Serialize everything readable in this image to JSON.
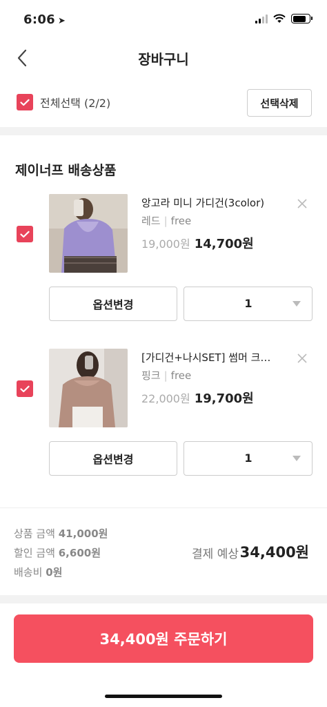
{
  "status": {
    "time": "6:06"
  },
  "header": {
    "title": "장바구니"
  },
  "select_all": {
    "label": "전체선택 (2/2)",
    "delete_label": "선택삭제"
  },
  "section": {
    "title": "제이너프 배송상품"
  },
  "items": [
    {
      "name": "앙고라 미니 가디건(3color)",
      "color": "레드",
      "size": "free",
      "price_original": "19,000원",
      "price_sale": "14,700원",
      "option_button": "옵션변경",
      "quantity": "1"
    },
    {
      "name": "[가디건+나시SET] 썸머 크…",
      "color": "핑크",
      "size": "free",
      "price_original": "22,000원",
      "price_sale": "19,700원",
      "option_button": "옵션변경",
      "quantity": "1"
    }
  ],
  "summary": {
    "product_amount_label": "상품 금액",
    "product_amount": "41,000원",
    "discount_label": "할인 금액",
    "discount_amount": "6,600원",
    "shipping_label": "배송비",
    "shipping_amount": "0원",
    "payment_label": "결제 예상",
    "payment_amount": "34,400원"
  },
  "order_button": {
    "label": "34,400원 주문하기"
  },
  "colors": {
    "accent": "#f5505f",
    "checkbox": "#e8435a"
  }
}
